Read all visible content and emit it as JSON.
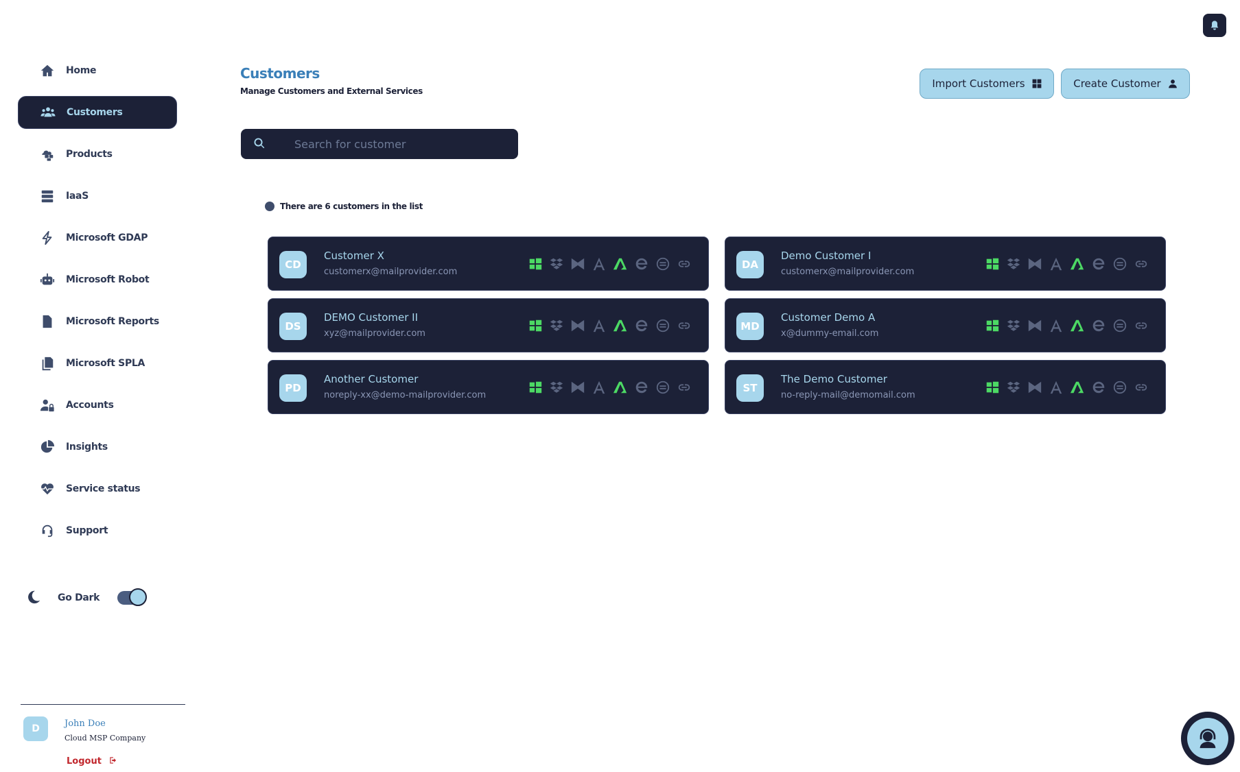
{
  "colors": {
    "accent": "#a7d6ec",
    "navy": "#1c2137",
    "title_blue": "#3a7fb8",
    "service_active": "#4cd964",
    "service_inactive": "#5b6580",
    "logout_red": "#c1272d"
  },
  "sidebar": {
    "items": [
      {
        "label": "Home",
        "icon": "home-icon",
        "active": false
      },
      {
        "label": "Customers",
        "icon": "users-icon",
        "active": true
      },
      {
        "label": "Products",
        "icon": "cloud-boxes-icon",
        "active": false
      },
      {
        "label": "IaaS",
        "icon": "server-icon",
        "active": false
      },
      {
        "label": "Microsoft GDAP",
        "icon": "lightning-icon",
        "active": false
      },
      {
        "label": "Microsoft Robot",
        "icon": "robot-icon",
        "active": false
      },
      {
        "label": "Microsoft Reports",
        "icon": "file-icon",
        "active": false
      },
      {
        "label": "Microsoft SPLA",
        "icon": "copy-icon",
        "active": false
      },
      {
        "label": "Accounts",
        "icon": "user-lock-icon",
        "active": false
      },
      {
        "label": "Insights",
        "icon": "pie-chart-icon",
        "active": false
      },
      {
        "label": "Service status",
        "icon": "heart-pulse-icon",
        "active": false
      },
      {
        "label": "Support",
        "icon": "headset-icon",
        "active": false
      }
    ],
    "dark_mode_label": "Go Dark",
    "user": {
      "initial": "D",
      "name": "John Doe",
      "company": "Cloud MSP Company",
      "logout_label": "Logout"
    }
  },
  "header": {
    "title": "Customers",
    "subtitle": "Manage Customers and External Services",
    "import_label": "Import Customers",
    "create_label": "Create Customer"
  },
  "search": {
    "placeholder": "Search for customer",
    "value": ""
  },
  "list": {
    "count_text": "There are 6 customers in the list"
  },
  "customers": [
    {
      "initials": "CD",
      "name": "Customer X",
      "email": "customerx@mailprovider.com"
    },
    {
      "initials": "DA",
      "name": "Demo Customer I",
      "email": "customerx@mailprovider.com"
    },
    {
      "initials": "DS",
      "name": "DEMO Customer II",
      "email": "xyz@mailprovider.com"
    },
    {
      "initials": "MD",
      "name": "Customer Demo A",
      "email": "x@dummy-email.com"
    },
    {
      "initials": "PD",
      "name": "Another Customer",
      "email": "noreply-xx@demo-mailprovider.com"
    },
    {
      "initials": "ST",
      "name": "The Demo Customer",
      "email": "no-reply-mail@demomail.com"
    }
  ],
  "services": [
    {
      "icon": "windows-icon",
      "active": true
    },
    {
      "icon": "dropbox-icon",
      "active": false
    },
    {
      "icon": "bowtie-icon",
      "active": false
    },
    {
      "icon": "acronis-icon",
      "active": false
    },
    {
      "icon": "azure-icon",
      "active": true
    },
    {
      "icon": "e-icon",
      "active": false
    },
    {
      "icon": "circle-e-icon",
      "active": false
    },
    {
      "icon": "link-icon",
      "active": false
    }
  ]
}
